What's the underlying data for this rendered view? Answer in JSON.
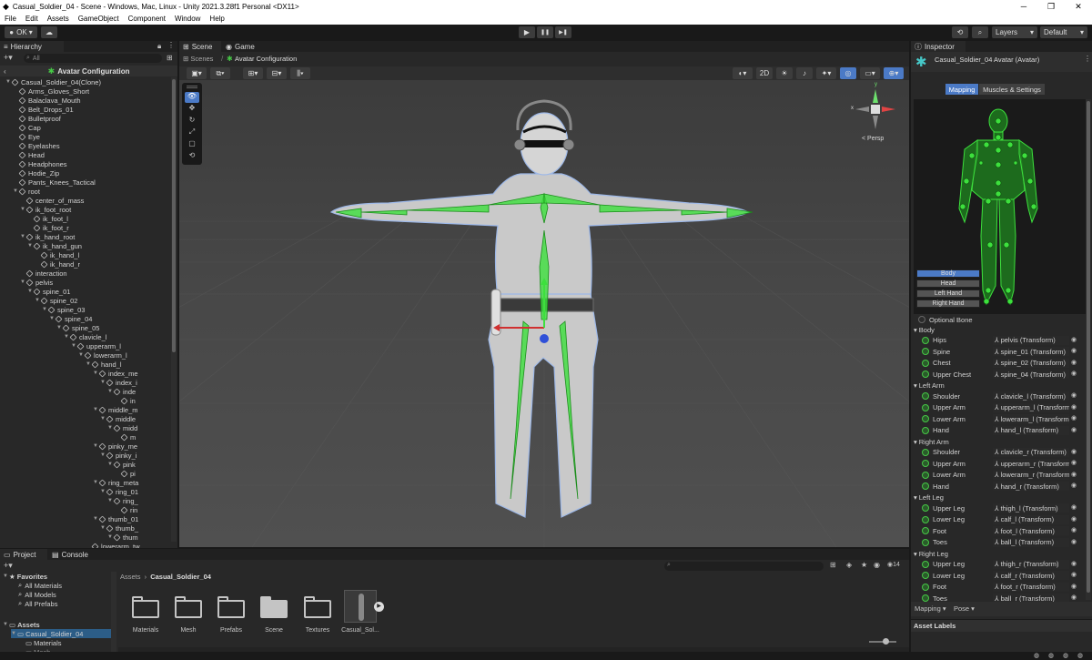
{
  "window": {
    "title": "Casual_Soldier_04 - Scene - Windows, Mac, Linux - Unity 2021.3.28f1 Personal <DX11>",
    "min": "─",
    "max": "❐",
    "close": "✕"
  },
  "menu": [
    "File",
    "Edit",
    "Assets",
    "GameObject",
    "Component",
    "Window",
    "Help"
  ],
  "toolbar": {
    "account": "OK",
    "play": "▶",
    "pause": "❚❚",
    "step": "▶❚",
    "layers": "Layers",
    "layout": "Default"
  },
  "hierarchy": {
    "tab": "Hierarchy",
    "search_placeholder": "All",
    "header": "Avatar Configuration",
    "rows": [
      {
        "label": "Casual_Soldier_04(Clone)",
        "indent": 0,
        "exp": true
      },
      {
        "label": "Arms_Gloves_Short",
        "indent": 1,
        "exp": false
      },
      {
        "label": "Balaclava_Mouth",
        "indent": 1,
        "exp": false
      },
      {
        "label": "Belt_Drops_01",
        "indent": 1,
        "exp": false
      },
      {
        "label": "Bulletproof",
        "indent": 1,
        "exp": false
      },
      {
        "label": "Cap",
        "indent": 1,
        "exp": false
      },
      {
        "label": "Eye",
        "indent": 1,
        "exp": false
      },
      {
        "label": "Eyelashes",
        "indent": 1,
        "exp": false
      },
      {
        "label": "Head",
        "indent": 1,
        "exp": false
      },
      {
        "label": "Headphones",
        "indent": 1,
        "exp": false
      },
      {
        "label": "Hodie_Zip",
        "indent": 1,
        "exp": false
      },
      {
        "label": "Pants_Knees_Tactical",
        "indent": 1,
        "exp": false
      },
      {
        "label": "root",
        "indent": 1,
        "exp": true
      },
      {
        "label": "center_of_mass",
        "indent": 2,
        "exp": false
      },
      {
        "label": "ik_foot_root",
        "indent": 2,
        "exp": true
      },
      {
        "label": "ik_foot_l",
        "indent": 3,
        "exp": false
      },
      {
        "label": "ik_foot_r",
        "indent": 3,
        "exp": false
      },
      {
        "label": "ik_hand_root",
        "indent": 2,
        "exp": true
      },
      {
        "label": "ik_hand_gun",
        "indent": 3,
        "exp": true
      },
      {
        "label": "ik_hand_l",
        "indent": 4,
        "exp": false
      },
      {
        "label": "ik_hand_r",
        "indent": 4,
        "exp": false
      },
      {
        "label": "interaction",
        "indent": 2,
        "exp": false
      },
      {
        "label": "pelvis",
        "indent": 2,
        "exp": true
      },
      {
        "label": "spine_01",
        "indent": 3,
        "exp": true
      },
      {
        "label": "spine_02",
        "indent": 4,
        "exp": true
      },
      {
        "label": "spine_03",
        "indent": 5,
        "exp": true
      },
      {
        "label": "spine_04",
        "indent": 6,
        "exp": true
      },
      {
        "label": "spine_05",
        "indent": 7,
        "exp": true
      },
      {
        "label": "clavicle_l",
        "indent": 8,
        "exp": true
      },
      {
        "label": "upperarm_l",
        "indent": 9,
        "exp": true
      },
      {
        "label": "lowerarm_l",
        "indent": 10,
        "exp": true
      },
      {
        "label": "hand_l",
        "indent": 11,
        "exp": true
      },
      {
        "label": "index_me",
        "indent": 12,
        "exp": true
      },
      {
        "label": "index_i",
        "indent": 13,
        "exp": true
      },
      {
        "label": "inde",
        "indent": 14,
        "exp": true
      },
      {
        "label": "in",
        "indent": 15,
        "exp": false
      },
      {
        "label": "middle_m",
        "indent": 12,
        "exp": true
      },
      {
        "label": "middle",
        "indent": 13,
        "exp": true
      },
      {
        "label": "midd",
        "indent": 14,
        "exp": true
      },
      {
        "label": "m",
        "indent": 15,
        "exp": false
      },
      {
        "label": "pinky_me",
        "indent": 12,
        "exp": true
      },
      {
        "label": "pinky_i",
        "indent": 13,
        "exp": true
      },
      {
        "label": "pink",
        "indent": 14,
        "exp": true
      },
      {
        "label": "pi",
        "indent": 15,
        "exp": false
      },
      {
        "label": "ring_meta",
        "indent": 12,
        "exp": true
      },
      {
        "label": "ring_01",
        "indent": 13,
        "exp": true
      },
      {
        "label": "ring_",
        "indent": 14,
        "exp": true
      },
      {
        "label": "rin",
        "indent": 15,
        "exp": false
      },
      {
        "label": "thumb_01",
        "indent": 12,
        "exp": true
      },
      {
        "label": "thumb_",
        "indent": 13,
        "exp": true
      },
      {
        "label": "thum",
        "indent": 14,
        "exp": true
      },
      {
        "label": "lowerarm_tw",
        "indent": 11,
        "exp": false
      }
    ]
  },
  "scene": {
    "tab_scene": "Scene",
    "tab_game": "Game",
    "breadcrumb_root": "Scenes",
    "breadcrumb_current": "Avatar Configuration",
    "persp": "< Persp",
    "btn_2d": "2D",
    "axis_x": "x",
    "axis_y": "y"
  },
  "project": {
    "tab_project": "Project",
    "tab_console": "Console",
    "favorites": "Favorites",
    "fav_items": [
      "All Materials",
      "All Models",
      "All Prefabs"
    ],
    "assets": "Assets",
    "asset_tree": [
      "Casual_Soldier_04",
      "Materials",
      "Mesh"
    ],
    "path_root": "Assets",
    "path_current": "Casual_Soldier_04",
    "items": [
      "Materials",
      "Mesh",
      "Prefabs",
      "Scene",
      "Textures",
      "Casual_Sol..."
    ],
    "count": "14"
  },
  "inspector": {
    "tab": "Inspector",
    "title": "Casual_Soldier_04 Avatar (Avatar)",
    "tab_mapping": "Mapping",
    "tab_muscles": "Muscles & Settings",
    "body_buttons": [
      "Body",
      "Head",
      "Left Hand",
      "Right Hand"
    ],
    "optional_bone": "Optional Bone",
    "groups": [
      {
        "name": "Body",
        "bones": [
          {
            "label": "Hips",
            "value": "pelvis (Transform)"
          },
          {
            "label": "Spine",
            "value": "spine_01 (Transform)"
          },
          {
            "label": "Chest",
            "value": "spine_02 (Transform)"
          },
          {
            "label": "Upper Chest",
            "value": "spine_04 (Transform)"
          }
        ]
      },
      {
        "name": "Left Arm",
        "bones": [
          {
            "label": "Shoulder",
            "value": "clavicle_l (Transform)"
          },
          {
            "label": "Upper Arm",
            "value": "upperarm_l (Transform)"
          },
          {
            "label": "Lower Arm",
            "value": "lowerarm_l (Transform)"
          },
          {
            "label": "Hand",
            "value": "hand_l (Transform)"
          }
        ]
      },
      {
        "name": "Right Arm",
        "bones": [
          {
            "label": "Shoulder",
            "value": "clavicle_r (Transform)"
          },
          {
            "label": "Upper Arm",
            "value": "upperarm_r (Transform)"
          },
          {
            "label": "Lower Arm",
            "value": "lowerarm_r (Transform)"
          },
          {
            "label": "Hand",
            "value": "hand_r (Transform)"
          }
        ]
      },
      {
        "name": "Left Leg",
        "bones": [
          {
            "label": "Upper Leg",
            "value": "thigh_l (Transform)"
          },
          {
            "label": "Lower Leg",
            "value": "calf_l (Transform)"
          },
          {
            "label": "Foot",
            "value": "foot_l (Transform)"
          },
          {
            "label": "Toes",
            "value": "ball_l (Transform)"
          }
        ]
      },
      {
        "name": "Right Leg",
        "bones": [
          {
            "label": "Upper Leg",
            "value": "thigh_r (Transform)"
          },
          {
            "label": "Lower Leg",
            "value": "calf_r (Transform)"
          },
          {
            "label": "Foot",
            "value": "foot_r (Transform)"
          },
          {
            "label": "Toes",
            "value": "ball_r (Transform)"
          }
        ]
      }
    ],
    "mapping_menu": "Mapping ▾",
    "pose_menu": "Pose ▾",
    "asset_labels": "Asset Labels"
  },
  "colors": {
    "accent": "#4b7ac6",
    "bone_green": "#3de03d"
  }
}
